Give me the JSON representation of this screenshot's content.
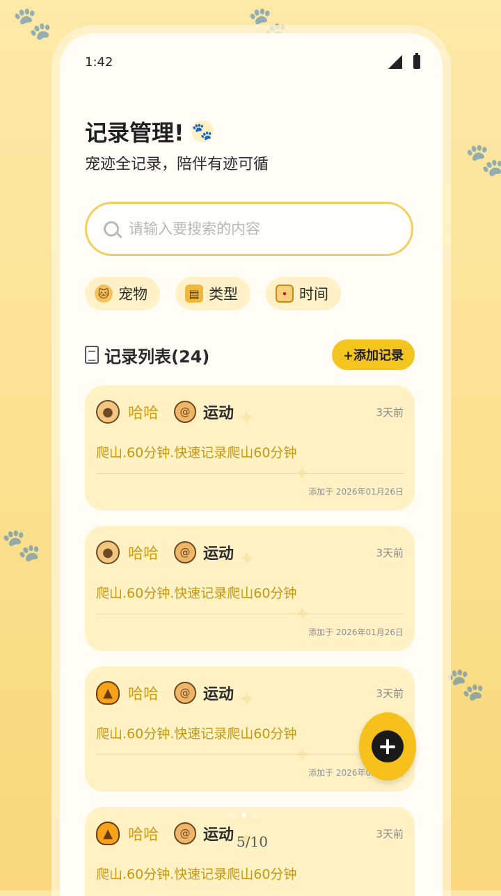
{
  "status_bar": {
    "time": "1:42"
  },
  "header": {
    "title": "记录管理!",
    "subtitle": "宠迹全记录，陪伴有迹可循"
  },
  "search": {
    "placeholder": "请输入要搜索的内容",
    "value": ""
  },
  "filters": [
    {
      "label": "宠物",
      "icon": "cat-icon"
    },
    {
      "label": "类型",
      "icon": "clipboard-icon"
    },
    {
      "label": "时间",
      "icon": "calendar-icon"
    }
  ],
  "list": {
    "title": "记录列表(24)",
    "add_label": "+添加记录",
    "records": [
      {
        "pet_icon": "hamster-icon",
        "pet": "哈哈",
        "type_icon": "activity-icon",
        "type": "运动",
        "ago": "3天前",
        "content": "爬山.60分钟.快速记录爬山60分钟",
        "added": "添加于 2026年01月26日"
      },
      {
        "pet_icon": "hamster-icon",
        "pet": "哈哈",
        "type_icon": "activity-icon",
        "type": "运动",
        "ago": "3天前",
        "content": "爬山.60分钟.快速记录爬山60分钟",
        "added": "添加于 2026年01月26日"
      },
      {
        "pet_icon": "parrot-icon",
        "pet": "哈哈",
        "type_icon": "activity-icon",
        "type": "运动",
        "ago": "3天前",
        "content": "爬山.60分钟.快速记录爬山60分钟",
        "added": "添加于 2026年01月26日"
      },
      {
        "pet_icon": "parrot-icon",
        "pet": "哈哈",
        "type_icon": "activity-icon",
        "type": "运动",
        "ago": "3天前",
        "content": "爬山.60分钟.快速记录爬山60分钟",
        "added": ""
      }
    ]
  },
  "pager": "5/10",
  "colors": {
    "accent": "#f5c51f",
    "card": "#fff3c6",
    "text_gold": "#c9960d"
  }
}
